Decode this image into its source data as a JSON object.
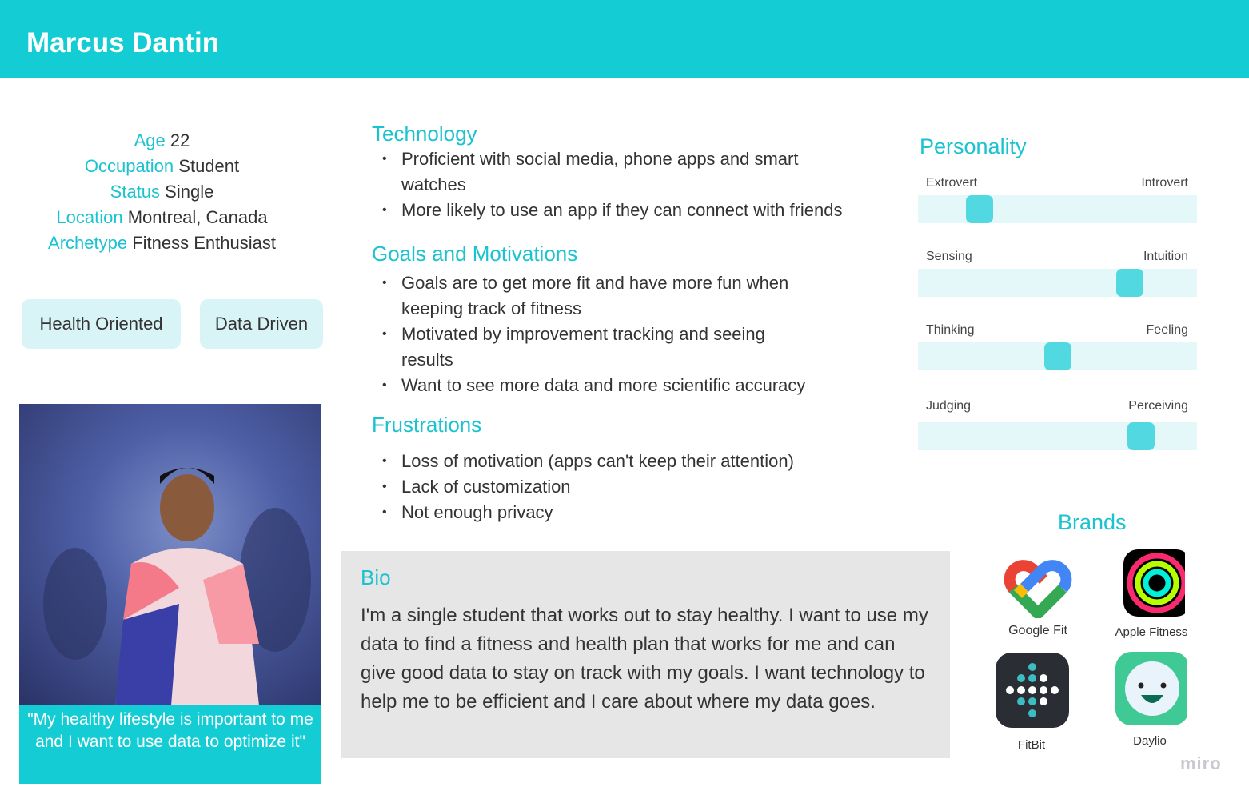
{
  "header": {
    "title": "Marcus Dantin"
  },
  "profile": {
    "age_label": "Age",
    "age": "22",
    "occupation_label": "Occupation",
    "occupation": "Student",
    "status_label": "Status",
    "status": "Single",
    "location_label": "Location",
    "location": "Montreal, Canada",
    "archetype_label": "Archetype",
    "archetype": "Fitness Enthusiast"
  },
  "tags": [
    "Health Oriented",
    "Data Driven"
  ],
  "quote": "\"My healthy lifestyle is important to me and I want to use data to optimize it\"",
  "sections": {
    "technology": {
      "title": "Technology",
      "items": [
        "Proficient with social media, phone apps and smart watches",
        "More likely to use an app if they can connect with friends"
      ]
    },
    "goals": {
      "title": "Goals and Motivations",
      "items": [
        "Goals are to get more fit and have more fun when keeping track of fitness",
        "Motivated by improvement tracking and seeing results",
        "Want to see more data and more scientific accuracy"
      ]
    },
    "frustrations": {
      "title": "Frustrations",
      "items": [
        "Loss of motivation (apps can't keep their attention)",
        "Lack of customization",
        "Not enough privacy"
      ]
    }
  },
  "bio": {
    "title": "Bio",
    "text": "I'm a single student that works out to stay healthy. I want to use my data to find a fitness and health plan that works for me and can give good data to stay on track with my goals. I want technology to help me to be efficient and I care about where my data goes."
  },
  "personality": {
    "title": "Personality",
    "traits": [
      {
        "left": "Extrovert",
        "right": "Introvert",
        "value": 0.22
      },
      {
        "left": "Sensing",
        "right": "Intuition",
        "value": 0.76
      },
      {
        "left": "Thinking",
        "right": "Feeling",
        "value": 0.5
      },
      {
        "left": "Judging",
        "right": "Perceiving",
        "value": 0.8
      }
    ]
  },
  "brands": {
    "title": "Brands",
    "items": [
      "Google Fit",
      "Apple Fitness",
      "FitBit",
      "Daylio"
    ]
  },
  "watermark": "miro",
  "colors": {
    "accent": "#14cdd4",
    "tag_bg": "#d8f4f7",
    "slider_thumb": "#52d8e0"
  }
}
